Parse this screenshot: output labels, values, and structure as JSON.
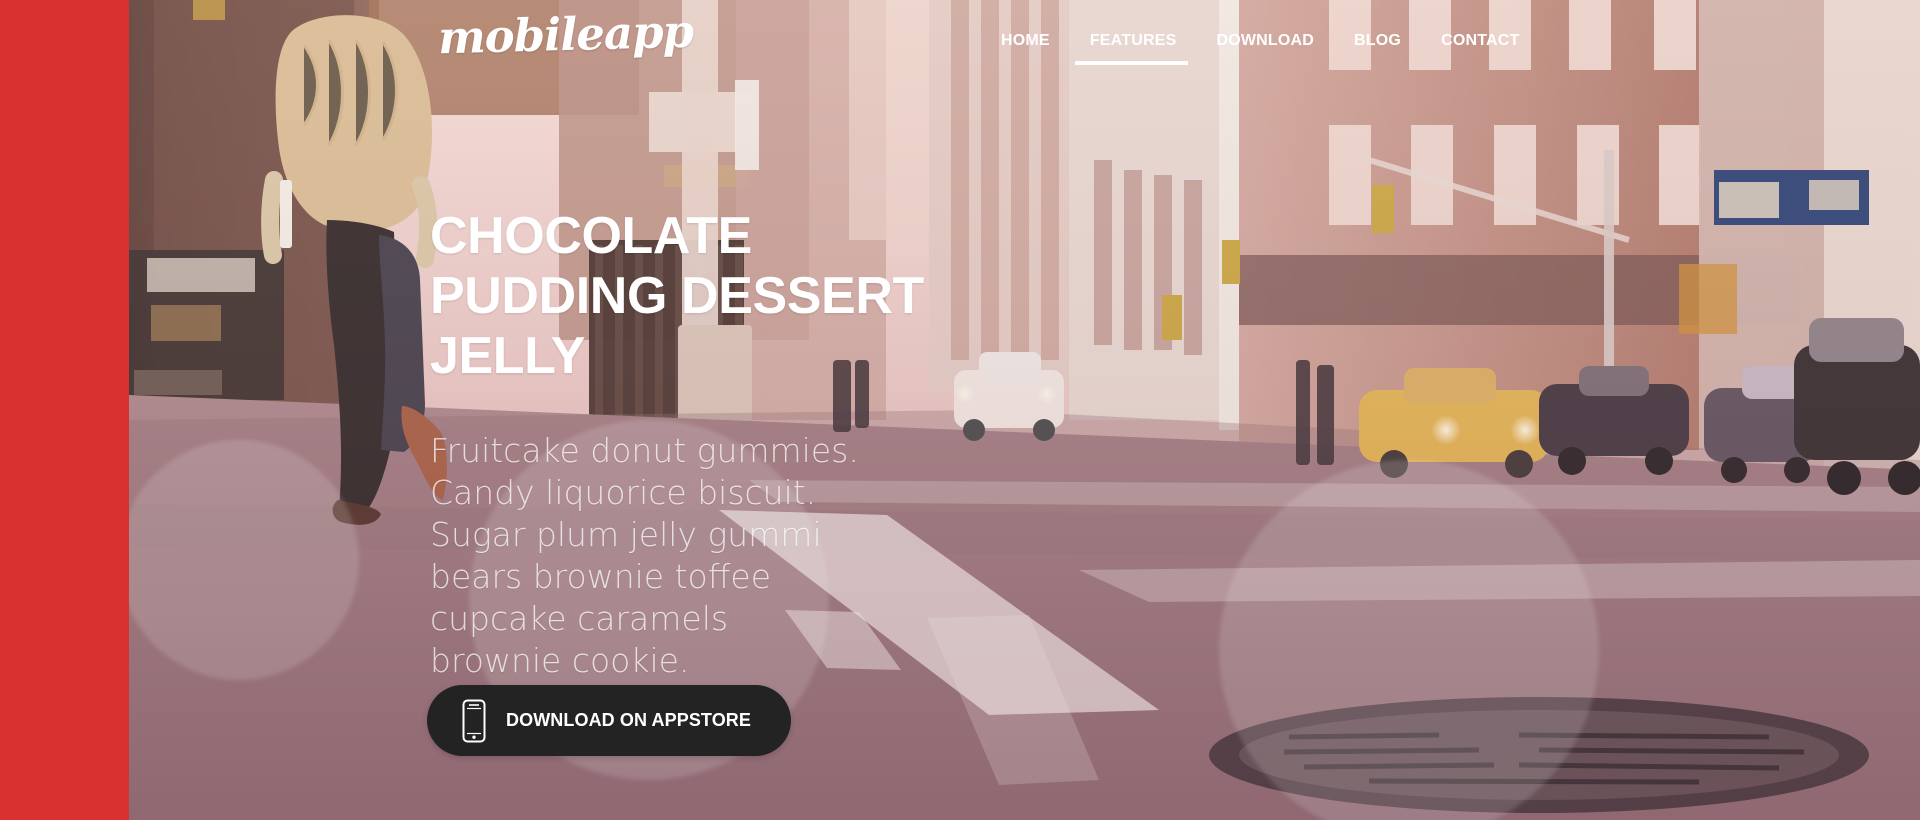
{
  "brand": {
    "logo_text": "mobileapp"
  },
  "nav": {
    "items": [
      {
        "label": "HOME",
        "active": false
      },
      {
        "label": "FEATURES",
        "active": true
      },
      {
        "label": "DOWNLOAD",
        "active": false
      },
      {
        "label": "BLOG",
        "active": false
      },
      {
        "label": "CONTACT",
        "active": false
      }
    ]
  },
  "hero": {
    "headline": "CHOCOLATE PUDDING DESSERT JELLY",
    "body": "Fruitcake donut gummies. Candy liquorice biscuit. Sugar plum jelly gummi bears brownie toffee cupcake caramels brownie cookie.",
    "cta_label": "DOWNLOAD ON APPSTORE"
  },
  "icons": {
    "cta_icon": "phone-icon"
  },
  "colors": {
    "sidebar_red": "#d8312f",
    "button_dark": "#232323",
    "nav_text": "#ffffff"
  }
}
